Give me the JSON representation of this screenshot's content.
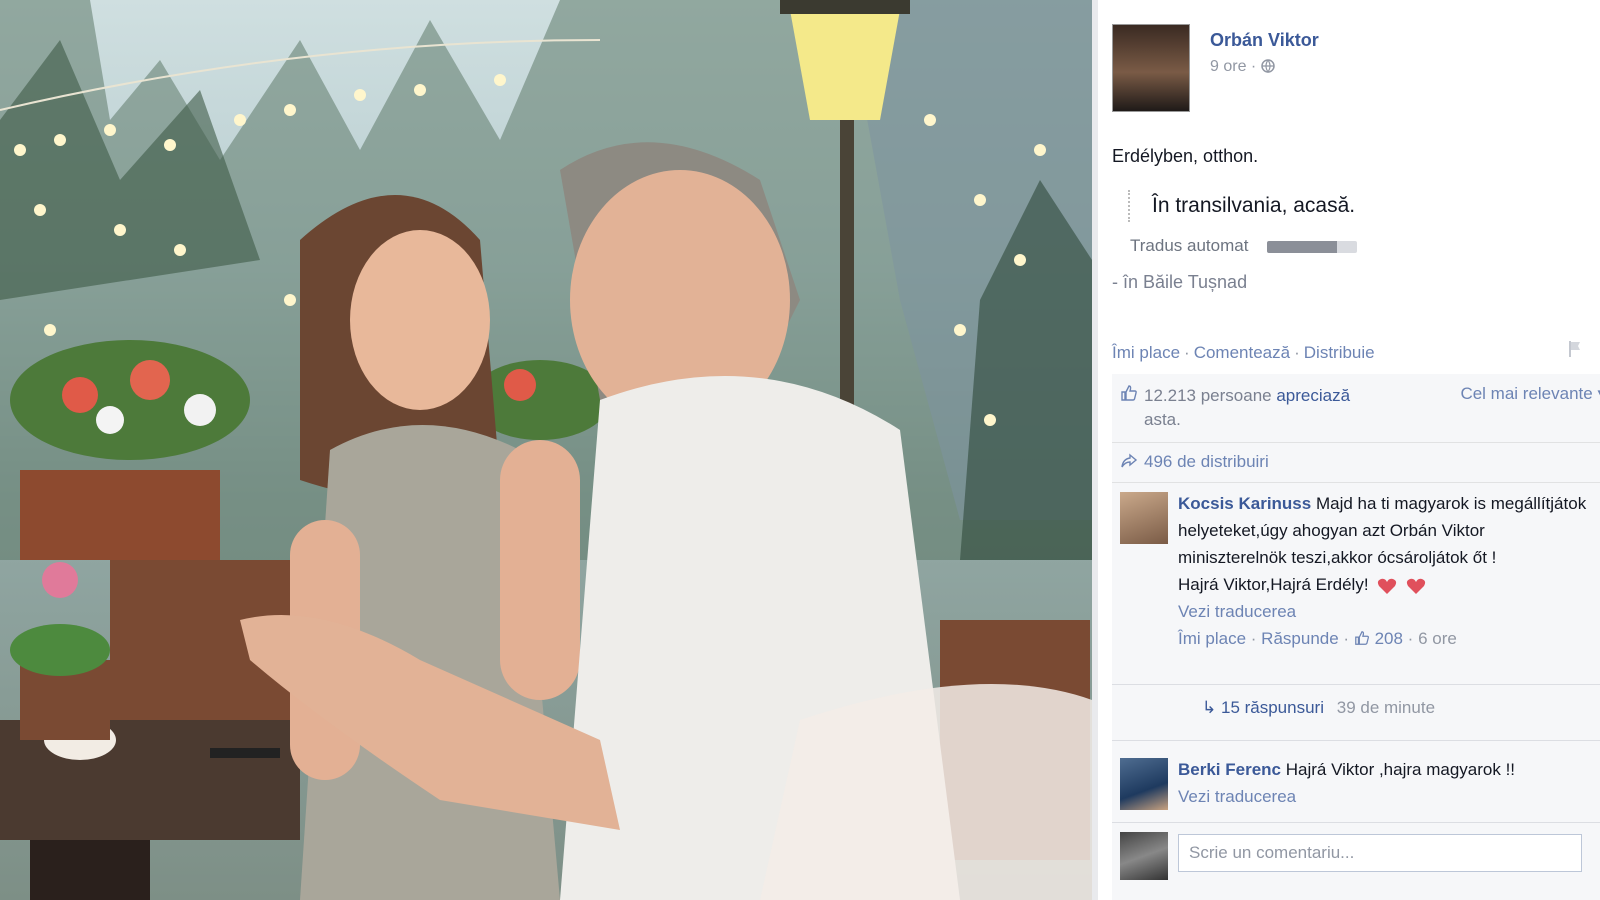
{
  "post": {
    "author": "Orbán Viktor",
    "time": "9 ore",
    "text": "Erdélyben, otthon.",
    "translation": "În transilvania, acasă.",
    "translation_label": "Tradus automat",
    "location": "- în Băile Tușnad",
    "actions": {
      "like": "Îmi place",
      "comment": "Comentează",
      "share": "Distribuie"
    }
  },
  "ufi": {
    "likes_count": "12.213 persoane",
    "likes_verb": "apreciază",
    "likes_suffix": "asta.",
    "sort": "Cel mai relevante",
    "shares": "496 de distribuiri"
  },
  "comments": [
    {
      "author": "Kocsis Karinuss",
      "text": "Majd ha ti magyarok is megállítjátok helyeteket,úgy ahogyan azt Orbán Viktor miniszterelnök teszi,akkor ócsároljátok őt !",
      "text2": "Hajrá Viktor,Hajrá Erdély!",
      "translate": "Vezi traducerea",
      "like": "Îmi place",
      "reply": "Răspunde",
      "likes": "208",
      "time": "6 ore",
      "replies": "15 răspunsuri",
      "replies_time": "39 de minute"
    },
    {
      "author": "Berki Ferenc",
      "text": "Hajrá Viktor ,hajra magyarok !!",
      "translate": "Vezi traducerea"
    }
  ],
  "composer": {
    "placeholder": "Scrie un comentariu..."
  },
  "icons": [
    "like-thumb-icon",
    "share-arrow-icon",
    "heart-icon",
    "reply-arrow-icon",
    "flag-icon",
    "globe-icon"
  ],
  "colors": {
    "link": "#3b5998",
    "muted": "#9197a3",
    "ufi_bg": "#f6f7f9",
    "heart": "#e0505c"
  }
}
